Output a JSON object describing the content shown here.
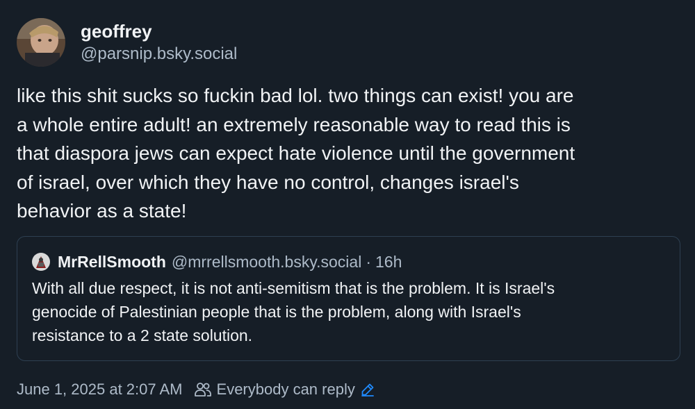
{
  "post": {
    "author": {
      "display_name": "geoffrey",
      "handle": "@parsnip.bsky.social"
    },
    "text": "like this shit sucks so fuckin bad lol. two things can exist! you are\na whole entire adult! an extremely reasonable way to read this is\nthat diaspora jews can expect hate violence until the government\nof israel, over which they have no control, changes israel's\nbehavior as a state!",
    "quote": {
      "display_name": "MrRellSmooth",
      "handle": "@mrrellsmooth.bsky.social",
      "separator": "·",
      "time": "16h",
      "text": "With all due respect, it is not anti-semitism that is the problem. It is Israel's\ngenocide of Palestinian people that is the problem, along with Israel's\nresistance to a 2 state solution."
    },
    "meta": {
      "timestamp": "June 1, 2025 at 2:07 AM",
      "reply_setting": "Everybody can reply",
      "people_icon": "people-icon",
      "edit_icon": "pencil-icon"
    }
  },
  "colors": {
    "background": "#161e27",
    "text_primary": "#f1f3f5",
    "text_secondary": "#aebbc9",
    "border": "#2e4052",
    "accent": "#208bfe"
  }
}
